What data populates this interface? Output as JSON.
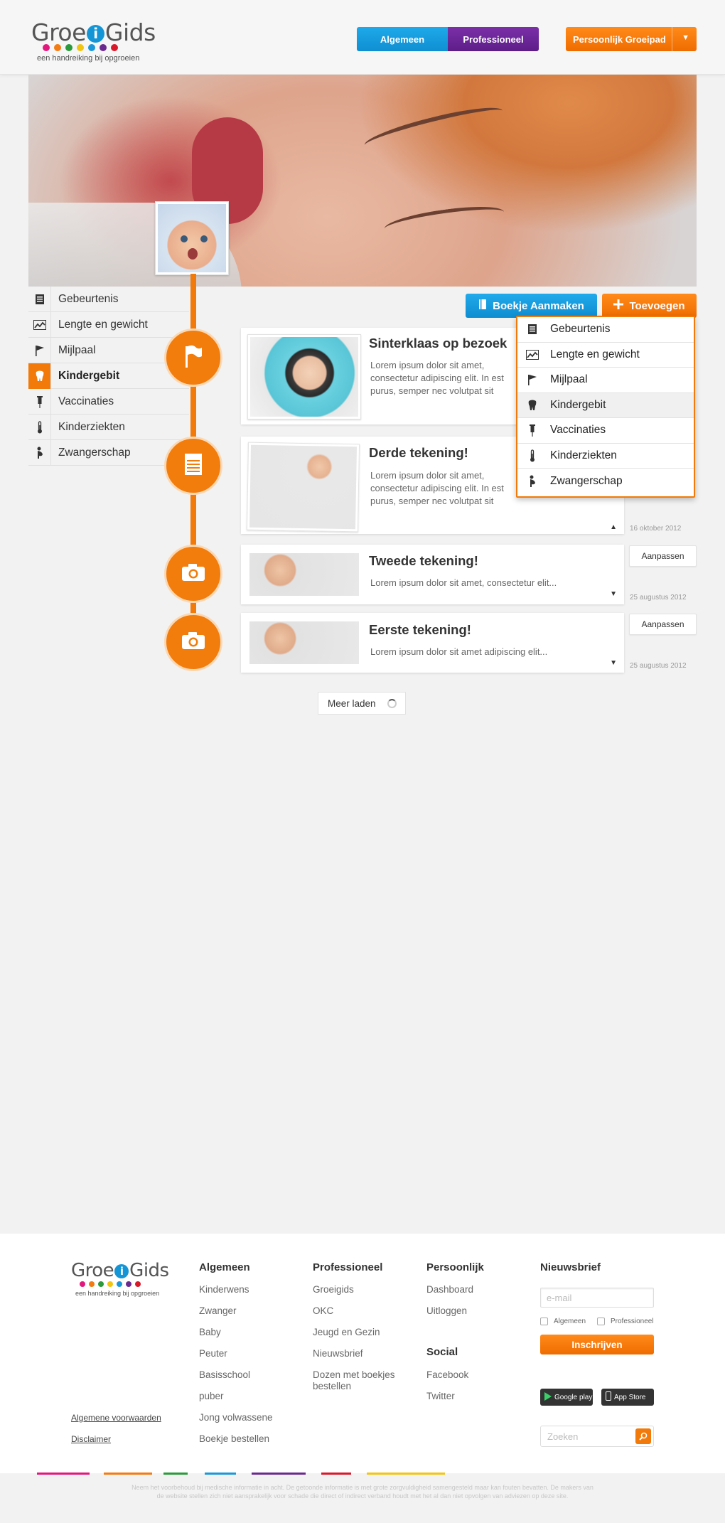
{
  "header": {
    "logo": {
      "word_pre": "Groe",
      "word_i": "i",
      "word_post": "Gids",
      "tagline": "een handreiking bij opgroeien",
      "dot_colors": [
        "#e2187e",
        "#f47a12",
        "#2a9a3b",
        "#f2c511",
        "#1b98d9",
        "#6b2a8f",
        "#d9192a"
      ]
    },
    "nav": {
      "algemeen": "Algemeen",
      "professioneel": "Professioneel",
      "groeipad": "Persoonlijk Groeipad",
      "groeipad_caret": "▼"
    }
  },
  "sidebar": {
    "items": [
      {
        "label": "Gebeurtenis",
        "icon": "notepad-icon"
      },
      {
        "label": "Lengte en gewicht",
        "icon": "chart-icon"
      },
      {
        "label": "Mijlpaal",
        "icon": "flag-icon"
      },
      {
        "label": "Kindergebit",
        "icon": "tooth-icon",
        "active": true
      },
      {
        "label": "Vaccinaties",
        "icon": "syringe-icon"
      },
      {
        "label": "Kinderziekten",
        "icon": "thermometer-icon"
      },
      {
        "label": "Zwangerschap",
        "icon": "pregnancy-icon"
      }
    ]
  },
  "actions": {
    "boekje": "Boekje Aanmaken",
    "toevoegen": "Toevoegen"
  },
  "dropdown": {
    "items": [
      "Gebeurtenis",
      "Lengte en gewicht",
      "Mijlpaal",
      "Kindergebit",
      "Vaccinaties",
      "Kinderziekten",
      "Zwangerschap"
    ]
  },
  "timeline": {
    "entries": [
      {
        "title": "Sinterklaas op bezoek",
        "text": "Lorem ipsum dolor sit amet, consectetur adipiscing elit. In est purus, semper nec volutpat sit amet, imperdiet at erat, consectetur adipiscing elit.",
        "node_icon": "flag-icon"
      },
      {
        "title": "Derde tekening!",
        "text": "Lorem ipsum dolor sit amet, consectetur adipiscing elit. In est purus, semper nec volutpat sit amet, imperdiet at erat, consectetur adipiscing elit.",
        "date": "16 oktober 2012",
        "caret": "▲",
        "node_icon": "notepad-icon"
      },
      {
        "title": "Tweede tekening!",
        "text": "Lorem ipsum dolor sit amet, consectetur elit...",
        "date": "25 augustus 2012",
        "caret": "▼",
        "edit": "Aanpassen",
        "node_icon": "camera-icon"
      },
      {
        "title": "Eerste tekening!",
        "text": "Lorem ipsum dolor sit amet adipiscing elit...",
        "date": "25 augustus 2012",
        "caret": "▼",
        "edit": "Aanpassen",
        "node_icon": "camera-icon"
      }
    ],
    "load_more": "Meer laden"
  },
  "footer": {
    "columns": [
      {
        "title": "Algemeen",
        "links": [
          "Kinderwens",
          "Zwanger",
          "Baby",
          "Peuter",
          "Basisschool",
          "puber",
          "Jong volwassene",
          "Boekje bestellen"
        ]
      },
      {
        "title": "Professioneel",
        "links": [
          "Groeigids",
          "OKC",
          "Jeugd en Gezin",
          "Nieuwsbrief",
          "Dozen met boekjes bestellen"
        ]
      },
      {
        "title": "Persoonlijk",
        "links": [
          "Dashboard",
          "Uitloggen"
        ]
      },
      {
        "title": "Social",
        "links": [
          "Facebook",
          "Twitter"
        ]
      }
    ],
    "newsletter": {
      "title": "Nieuwsbrief",
      "email_placeholder": "e-mail",
      "option_algemeen": "Algemeen",
      "option_professioneel": "Professioneel",
      "subscribe": "Inschrijven"
    },
    "stores": {
      "google": "Google play",
      "apple": "App Store"
    },
    "search_placeholder": "Zoeken",
    "legal": {
      "terms": "Algemene voorwaarden",
      "disclaimer": "Disclaimer"
    },
    "disclaimer_text": "Neem het voorbehoud bij medische informatie in acht. De getoonde informatie is met grote zorgvuldigheid samengesteld maar kan fouten bevatten. De makers van de website stellen zich niet aansprakelijk voor schade die direct of indirect verband houdt met het al dan niet opvolgen van adviezen op deze site.",
    "color_bar": [
      "#e2187e",
      "#f47a12",
      "#2a9a3b",
      "#1b98d9",
      "#6b2a8f",
      "#d9192a",
      "#f2c511"
    ]
  },
  "colors": {
    "orange": "#f17a0a",
    "blue": "#1495d6",
    "purple": "#6b2a8f"
  }
}
